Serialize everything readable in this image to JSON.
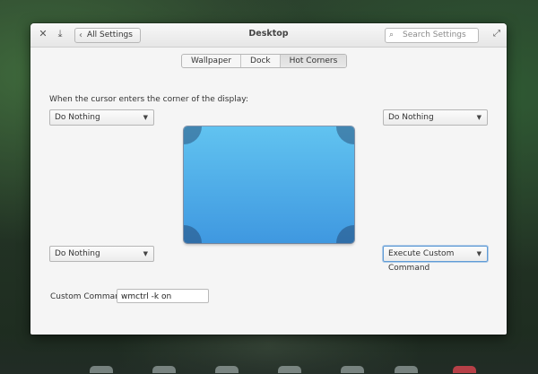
{
  "window": {
    "title": "Desktop",
    "back_label": "All Settings",
    "search_placeholder": "Search Settings"
  },
  "tabs": [
    {
      "label": "Wallpaper",
      "active": false
    },
    {
      "label": "Dock",
      "active": false
    },
    {
      "label": "Hot Corners",
      "active": true
    }
  ],
  "hot_corners": {
    "prompt": "When the cursor enters the corner of the display:",
    "top_left": "Do Nothing",
    "top_right": "Do Nothing",
    "bottom_left": "Do Nothing",
    "bottom_right": "Execute Custom Command",
    "custom_command_label": "Custom Command:",
    "custom_command_value": "wmctrl -k on"
  },
  "colors": {
    "accent": "#3f98e0",
    "screen_top": "#61c3f0"
  }
}
